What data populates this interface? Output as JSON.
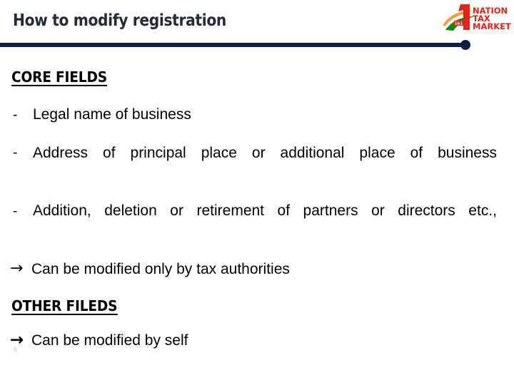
{
  "header": {
    "title": "How to modify registration",
    "logo": {
      "numeral": "1",
      "line1": "NATION",
      "line2": "TAX",
      "line3": "MARKET",
      "brand_color": "#e2231a",
      "saffron": "#ff9933",
      "white": "#ffffff",
      "green": "#138808",
      "tag": "1&1"
    },
    "rule_color": "#0d1f45"
  },
  "body": {
    "core_section": {
      "heading": "CORE FIELDS",
      "bullets": [
        {
          "marker": "-",
          "text": "Legal name of business",
          "justified": false
        },
        {
          "marker": "-",
          "text": "Address of principal place or additional place of business",
          "justified": true
        },
        {
          "marker": "-",
          "text": "Addition, deletion or retirement of partners or directors etc.,",
          "justified": true
        }
      ],
      "note": {
        "arrow": "→",
        "text": "Can be modified only by tax authorities"
      }
    },
    "other_section": {
      "heading": "OTHER FILEDS",
      "note": {
        "arrow": "→",
        "text": "Can be modified by self"
      }
    }
  }
}
